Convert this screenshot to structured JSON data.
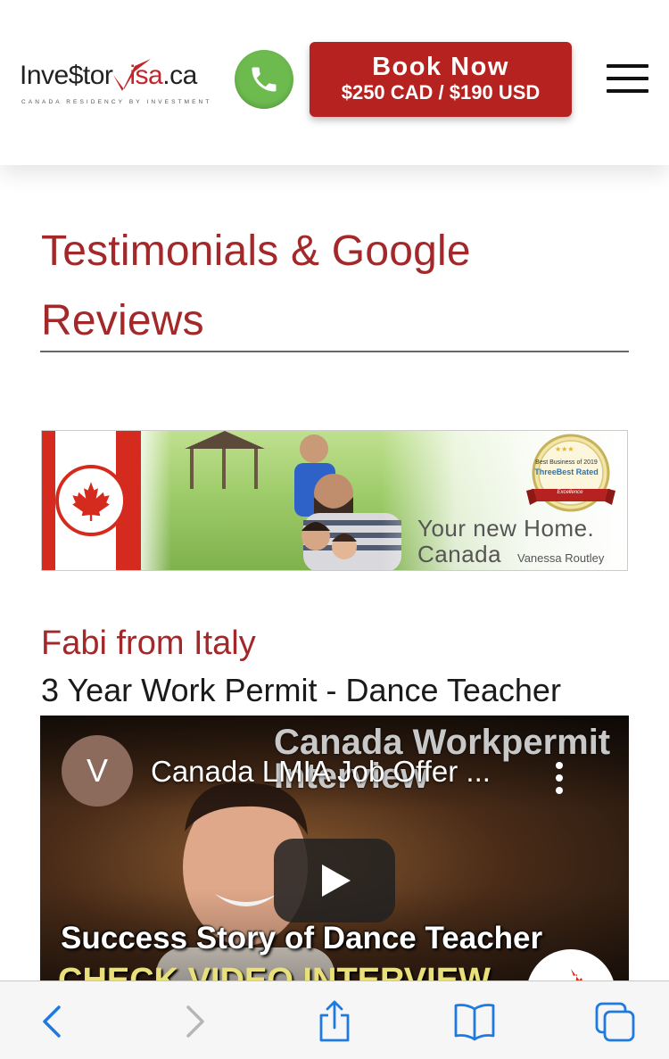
{
  "header": {
    "logo": {
      "part1": "Inve",
      "dollar": "$",
      "part2": "tor",
      "visa_red": "V",
      "part3": "isa",
      "tld": ".ca",
      "tagline": "CANADA RESIDENCY BY INVESTMENT"
    },
    "book_button": {
      "title": "Book Now",
      "price": "$250 CAD / $190 USD"
    }
  },
  "main": {
    "page_title": "Testimonials & Google Reviews",
    "banner": {
      "badge_line": "Best Business of 2019",
      "badge_brand": "ThreeBest Rated",
      "badge_ribbon": "Excellence",
      "tagline_1": "Your new Home.",
      "tagline_2": "Canada",
      "author": "Vanessa Routley"
    },
    "testimonial": {
      "name": "Fabi from Italy",
      "subtitle": "3 Year Work Permit - Dance Teacher"
    },
    "video": {
      "channel_initial": "V",
      "title": "Canada LMIA Job Offer ...",
      "bg_title_1": "Canada Workpermit",
      "bg_title_2": "Interview",
      "caption": "Success Story of Dance Teacher",
      "caption_2": "CHECK VIDEO INTERVIEW"
    }
  },
  "colors": {
    "brand_red": "#a3282a",
    "button_red": "#b5221f",
    "phone_green": "#6dbb4f",
    "safari_blue": "#1f7ae0"
  },
  "toolbar": {
    "icons": [
      "back-icon",
      "forward-icon",
      "share-icon",
      "bookmarks-icon",
      "tabs-icon"
    ]
  }
}
